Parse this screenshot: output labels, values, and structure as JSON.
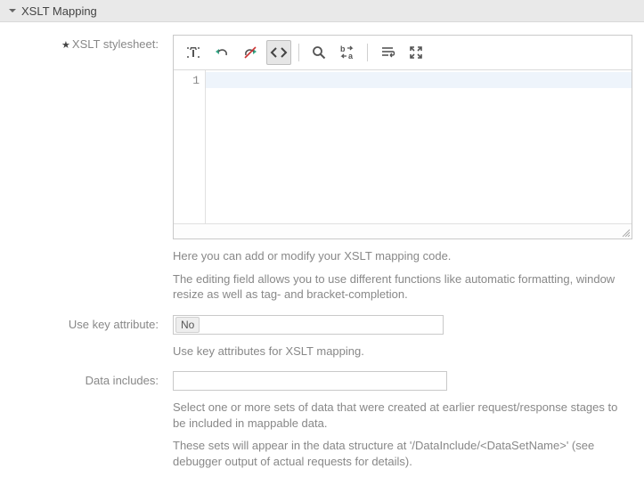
{
  "section": {
    "title": "XSLT Mapping"
  },
  "fields": {
    "stylesheet": {
      "label": "XSLT stylesheet:",
      "gutter_line": "1",
      "help1": "Here you can add or modify your XSLT mapping code.",
      "help2": "The editing field allows you to use different functions like automatic formatting, window resize as well as tag- and bracket-completion."
    },
    "useKey": {
      "label": "Use key attribute:",
      "value": "No",
      "help": "Use key attributes for XSLT mapping."
    },
    "dataIncludes": {
      "label": "Data includes:",
      "value": "",
      "help1": "Select one or more sets of data that were created at earlier request/response stages to be included in mappable data.",
      "help2": "These sets will appear in the data structure at '/DataInclude/<DataSetName>' (see debugger output of actual requests for details)."
    }
  },
  "toolbar": {
    "format": "format-icon",
    "undo": "undo-icon",
    "redo": "redo-icon",
    "brackets": "angle-brackets-icon",
    "search": "search-icon",
    "replace": "replace-icon",
    "wrap": "wrap-icon",
    "fullscreen": "fullscreen-icon"
  }
}
